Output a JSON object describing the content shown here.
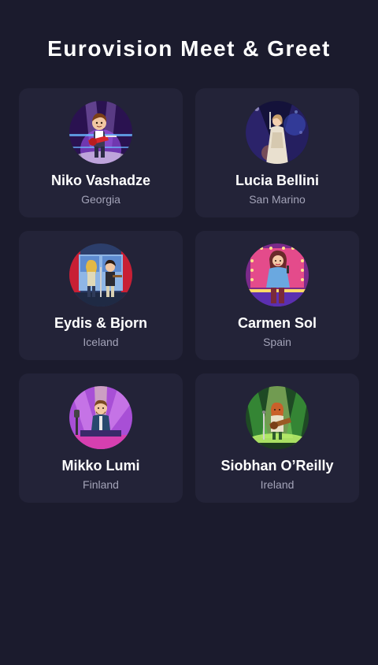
{
  "page": {
    "title": "Eurovision Meet & Greet"
  },
  "artists": [
    {
      "name": "Niko Vashadze",
      "country": "Georgia",
      "avatar": "rock-singer-with-guitar-illustration"
    },
    {
      "name": "Lucia Bellini",
      "country": "San Marino",
      "avatar": "singer-in-gown-on-stage-illustration"
    },
    {
      "name": "Eydis & Bjorn",
      "country": "Iceland",
      "avatar": "duo-performers-illustration"
    },
    {
      "name": "Carmen Sol",
      "country": "Spain",
      "avatar": "flamenco-singer-illustration"
    },
    {
      "name": "Mikko Lumi",
      "country": "Finland",
      "avatar": "dj-performer-illustration"
    },
    {
      "name": "Siobhan O’Reilly",
      "country": "Ireland",
      "avatar": "folk-guitarist-illustration"
    }
  ],
  "colors": {
    "background": "#1b1b2d",
    "card": "#232338",
    "text": "#ffffff",
    "muted_text": "#a3a3b8"
  }
}
